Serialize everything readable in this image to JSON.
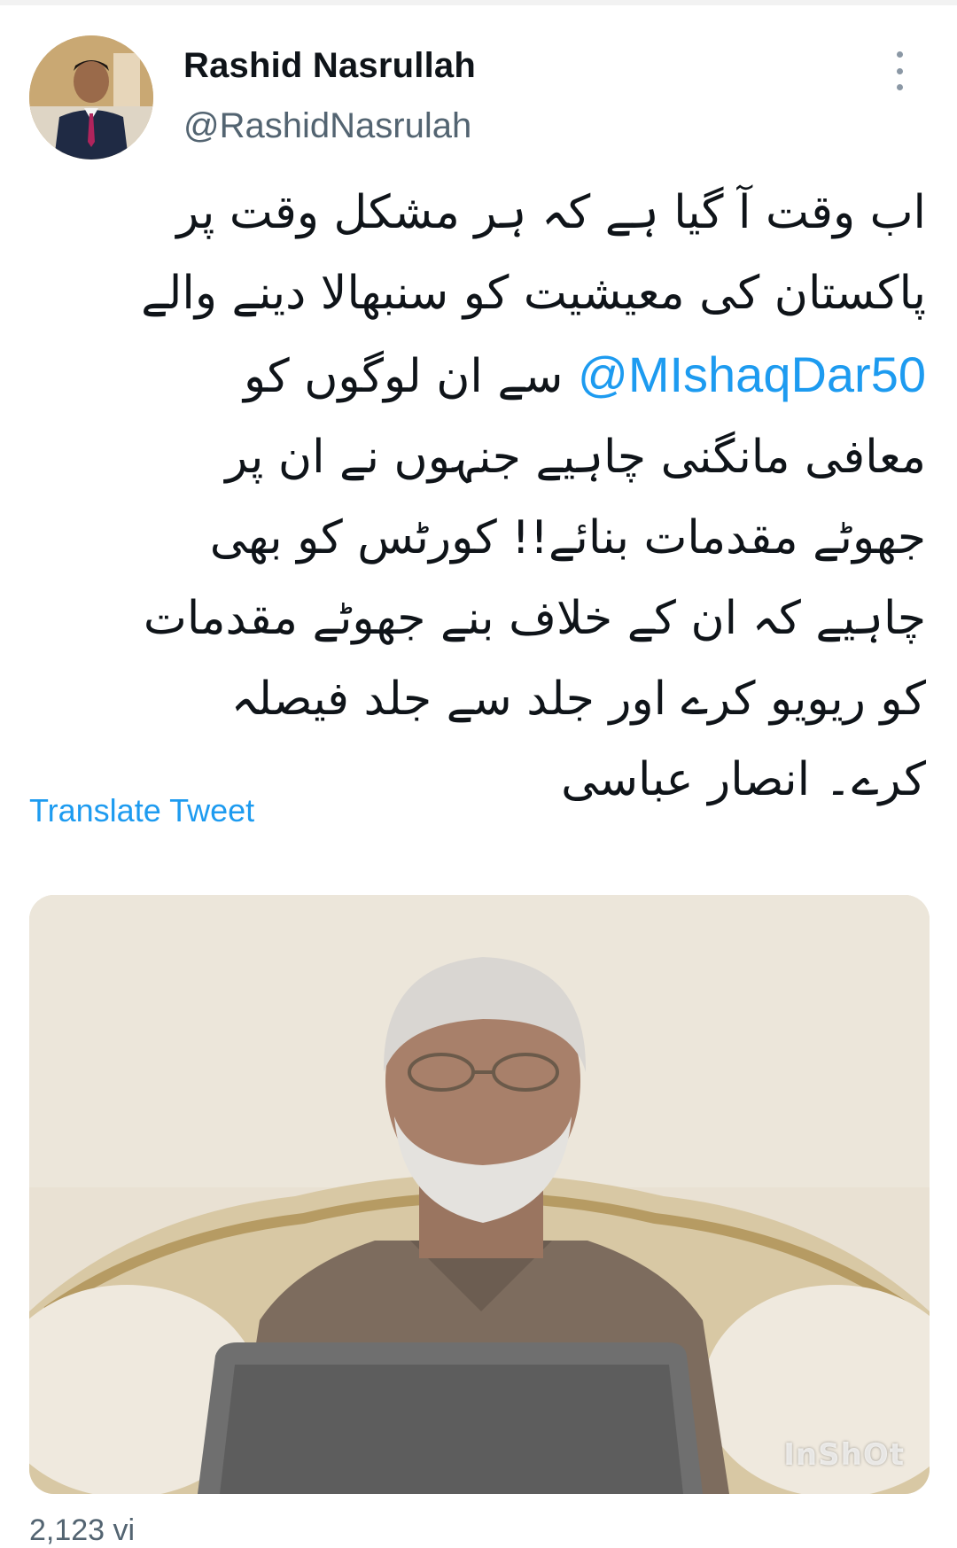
{
  "tweet": {
    "author_name": "Rashid Nasrullah",
    "author_handle": "@RashidNasrulah",
    "text_lines": [
      "اب وقت آ گیا ہے کہ ہر مشکل وقت پر",
      "پاکستان کی معیشیت کو سنبھالا دینے والے",
      {
        "mention": "@MIshaqDar50",
        "rest": " سے ان لوگوں کو"
      },
      "معافی مانگنی چاہیے جنہوں نے ان پر",
      "جھوٹے مقدمات بنائے!! کورٹس کو بھی",
      "چاہیے کہ ان کے خلاف بنے جھوٹے مقدمات",
      "کو ریویو کرے اور جلد سے جلد فیصلہ",
      "کرے۔ انصار عباسی"
    ],
    "line1": "اب وقت آ گیا ہے کہ ہر مشکل وقت پر",
    "line2": "پاکستان کی معیشیت کو سنبھالا دینے والے",
    "mention": "@MIshaqDar50",
    "line3_rest": " سے ان لوگوں کو",
    "line4": "معافی مانگنی چاہیے جنہوں نے ان پر",
    "line5": "جھوٹے مقدمات بنائے!! کورٹس کو بھی",
    "line6": "چاہیے کہ ان کے خلاف بنے جھوٹے مقدمات",
    "line7": "کو ریویو کرے اور جلد سے جلد فیصلہ",
    "line8": "کرے۔ انصار عباسی",
    "translate_label": "Translate Tweet",
    "media_watermark": "InShOt",
    "partial_footer": "2,123 vi"
  },
  "icons": {
    "more": "more-vertical-icon",
    "avatar": "avatar"
  },
  "colors": {
    "link": "#1d9bf0",
    "text": "#0f1419",
    "secondary": "#536471"
  }
}
